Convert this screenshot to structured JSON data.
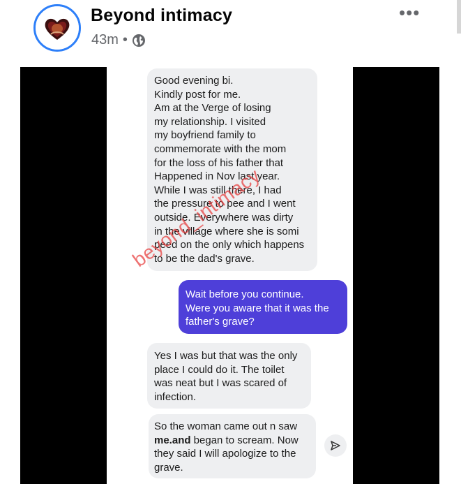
{
  "post": {
    "page_name": "Beyond intimacy",
    "time": "43m",
    "separator": "•",
    "more_label": "•••",
    "privacy_icon": "globe-icon"
  },
  "screenshot": {
    "watermark": "beyond_intimacy",
    "messages": [
      {
        "direction": "incoming",
        "lines": [
          "Good evening bi.",
          "Kindly post for me.",
          "Am at the Verge of losing",
          "my relationship. I visited",
          "my boyfriend family to",
          "commemorate with the mom",
          "for the loss of his father that",
          "Happened in Nov last year.",
          "While I was still there, I had",
          "the pressure to pee and I went",
          "outside. Everywhere was dirty",
          "in the village where she is somi",
          "peed on the only which happens",
          "to be the dad's grave."
        ]
      },
      {
        "direction": "outgoing",
        "lines": [
          "Wait before you continue.",
          "Were you aware that it was the",
          "father's grave?"
        ]
      },
      {
        "direction": "incoming",
        "lines": [
          "Yes I was but that was the only",
          "place I could do it. The toilet",
          "was neat but I was scared of",
          "infection."
        ]
      },
      {
        "direction": "incoming",
        "line1": "So the woman came out n saw",
        "line2_bold": "me.and",
        "line2_rest": " began to scream. Now",
        "line3": "they said I will apologize to the",
        "line4": "grave."
      }
    ],
    "send_icon": "send-icon"
  },
  "colors": {
    "outgoing_bubble": "#4e3fd9",
    "incoming_bubble": "#eeeff1",
    "avatar_ring": "#2d7ff9",
    "watermark": "#e83c3c"
  }
}
